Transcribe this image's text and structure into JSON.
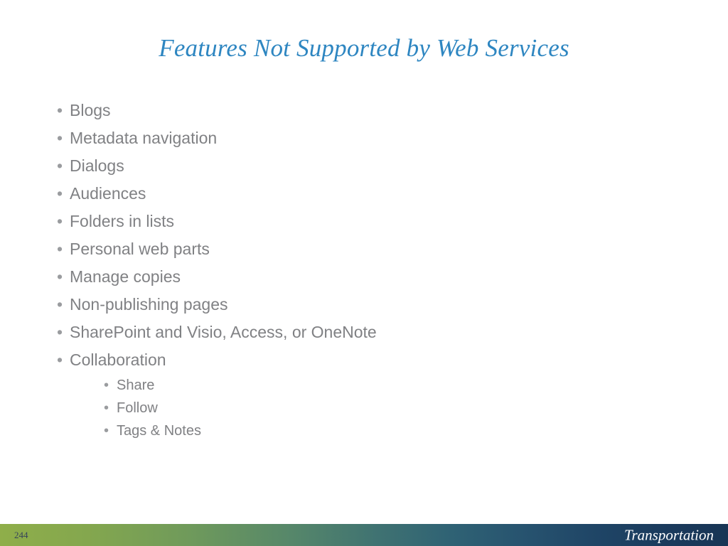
{
  "slide": {
    "title": "Features Not Supported by Web Services",
    "title_color": "#2e86c1",
    "background_color": "#ffffff",
    "body_text_color": "#808184",
    "bullet_glyph": "•",
    "bullets": [
      {
        "level": 1,
        "text": "Blogs"
      },
      {
        "level": 1,
        "text": "Metadata navigation"
      },
      {
        "level": 1,
        "text": "Dialogs"
      },
      {
        "level": 1,
        "text": "Audiences"
      },
      {
        "level": 1,
        "text": "Folders in lists"
      },
      {
        "level": 1,
        "text": "Personal web parts"
      },
      {
        "level": 1,
        "text": "Manage copies"
      },
      {
        "level": 1,
        "text": "Non-publishing pages"
      },
      {
        "level": 1,
        "text": "SharePoint and Visio, Access, or OneNote"
      },
      {
        "level": 1,
        "text": "Collaboration"
      },
      {
        "level": 2,
        "text": "Share"
      },
      {
        "level": 2,
        "text": "Follow"
      },
      {
        "level": 2,
        "text": "Tags & Notes"
      }
    ]
  },
  "footer": {
    "page_number": "244",
    "label": "Transportation",
    "gradient_start_color": "#8fae4a",
    "gradient_end_color": "#183555",
    "label_color": "#ffffff",
    "page_number_color": "#36435a"
  }
}
